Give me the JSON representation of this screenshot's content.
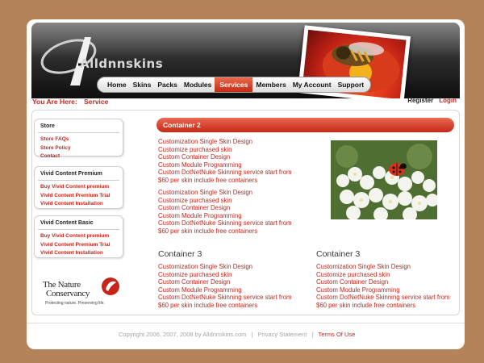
{
  "brand": {
    "logo_text": "Alldnnskins"
  },
  "nav": {
    "items": [
      "Home",
      "Skins",
      "Packs",
      "Modules",
      "Services",
      "Members",
      "My Account",
      "Support"
    ],
    "active": "Services"
  },
  "breadcrumb": {
    "label": "You Are Here:",
    "current": "Service"
  },
  "account": {
    "register": "Register",
    "login": "Login"
  },
  "sidebar": {
    "store": {
      "title": "Store",
      "items": [
        "Store FAQs",
        "Store Policy",
        "Contact"
      ]
    },
    "premium": {
      "title": "Vivid Content Premium",
      "items": [
        "Buy Vivid Content premium",
        "Vivid Content Premium Trial",
        "Vivid Content Installation"
      ]
    },
    "basic": {
      "title": "Vivid Content Basic",
      "items": [
        "Buy Vivid Content premium",
        "Vivid Content Premium Trial",
        "Vivid Content Installation"
      ]
    },
    "sponsor": {
      "name_line1": "The Nature",
      "name_line2": "Conservancy",
      "tagline": "Protecting nature. Preserving life."
    }
  },
  "main": {
    "container2_title": "Container 2",
    "container3_title": "Container 3",
    "service_lines": [
      "Customization Single Skin Design",
      "Customize purchased skin",
      "Custom Container Design",
      "Custom Module Programming",
      "Custom DotNetNuke Skinning service start from",
      "$60 per skin include free containers"
    ]
  },
  "footer": {
    "copyright": "Copyright 2006, 2007, 2008 by Alldnnskins.com",
    "privacy": "Privacy Statement",
    "terms": "Terms Of Use"
  },
  "colors": {
    "accent": "#c6251b",
    "background": "#b5835a",
    "header": "#1a1a1a"
  }
}
